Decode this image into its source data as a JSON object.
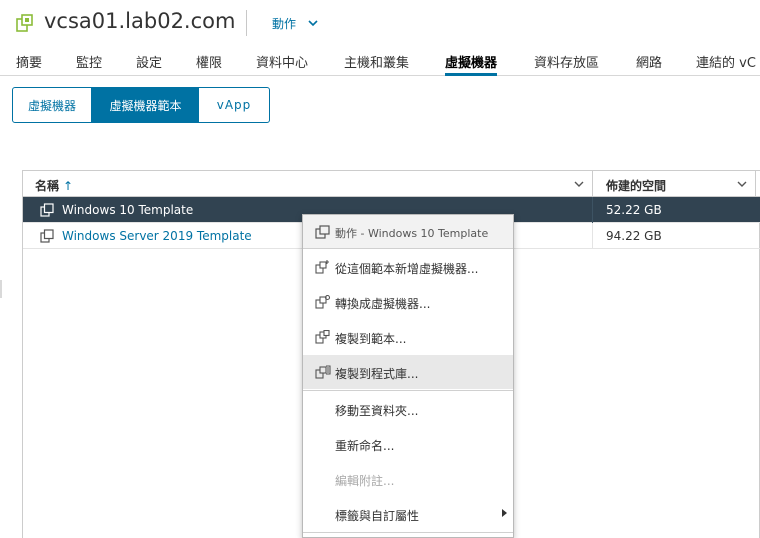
{
  "header": {
    "title": "vcsa01.lab02.com",
    "actions_label": "動作"
  },
  "tabs": [
    "摘要",
    "監控",
    "設定",
    "權限",
    "資料中心",
    "主機和叢集",
    "虛擬機器",
    "資料存放區",
    "網路",
    "連結的 vC"
  ],
  "active_tab": "虛擬機器",
  "segments": [
    "虛擬機器",
    "虛擬機器範本",
    "vApp"
  ],
  "active_segment": "虛擬機器範本",
  "grid": {
    "columns": [
      "名稱",
      "佈建的空間"
    ],
    "rows": [
      {
        "name": "Windows 10 Template",
        "size": "52.22 GB",
        "selected": true
      },
      {
        "name": "Windows Server 2019 Template",
        "size": "94.22 GB",
        "selected": false
      }
    ]
  },
  "context_menu": {
    "header": "動作 - Windows 10 Template",
    "items": [
      {
        "label": "從這個範本新增虛擬機器...",
        "icon": "new-vm-from-template-icon"
      },
      {
        "label": "轉換成虛擬機器...",
        "icon": "convert-to-vm-icon"
      },
      {
        "label": "複製到範本...",
        "icon": "clone-to-template-icon"
      },
      {
        "label": "複製到程式庫...",
        "icon": "clone-to-library-icon",
        "hover": true
      },
      {
        "label": "移動至資料夾..."
      },
      {
        "label": "重新命名..."
      },
      {
        "label": "編輯附註...",
        "disabled": true
      },
      {
        "label": "標籤與自訂屬性",
        "submenu": true
      }
    ]
  },
  "colors": {
    "accent": "#0072a3",
    "selected_row": "#314351",
    "host_icon": "#8cbc3a"
  }
}
